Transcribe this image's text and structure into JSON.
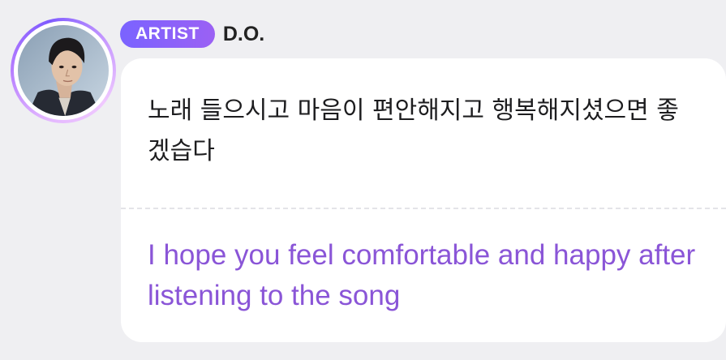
{
  "post": {
    "author": {
      "role_badge": "ARTIST",
      "name": "D.O."
    },
    "message": {
      "original_text": "노래 들으시고 마음이 편안해지고 행복해지셨으면 좋겠습다",
      "translated_text": "I hope you feel comfortable and happy after listening to the song"
    }
  },
  "colors": {
    "page_background": "#efeff2",
    "bubble_background": "#ffffff",
    "badge_gradient_start": "#7a63ff",
    "badge_gradient_end": "#9b61f4",
    "translation_text": "#8a55d7",
    "name_text": "#222222"
  },
  "icons": {
    "avatar": "profile-photo"
  }
}
